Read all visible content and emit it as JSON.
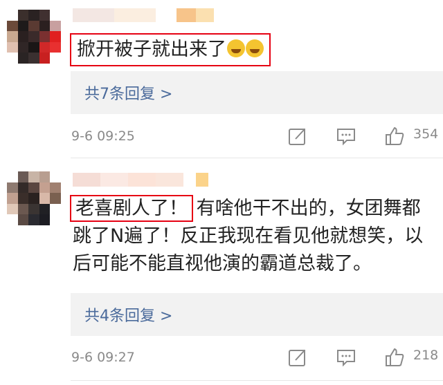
{
  "comments": [
    {
      "text": "掀开被子就出来了",
      "emojis": [
        "crying-laughing-emoji",
        "laughing-emoji"
      ],
      "replies": "共7条回复 >",
      "time": "9-6 09:25",
      "likes": "354"
    },
    {
      "text_highlight": "老喜剧人了！",
      "text_rest": "有啥他干不出的，女团舞都跳了N遍了！反正我现在看见他就想笑，以后可能不能直视他演的霸道总裁了。",
      "replies": "共4条回复 >",
      "time": "9-6 09:27",
      "likes": "218"
    }
  ],
  "colors": {
    "highlight": "#e60012",
    "link": "#4a6a9b",
    "meta": "#8a8a8a",
    "reply_bg": "#f2f2f2"
  },
  "icons": [
    "share-icon",
    "comment-icon",
    "like-icon"
  ]
}
